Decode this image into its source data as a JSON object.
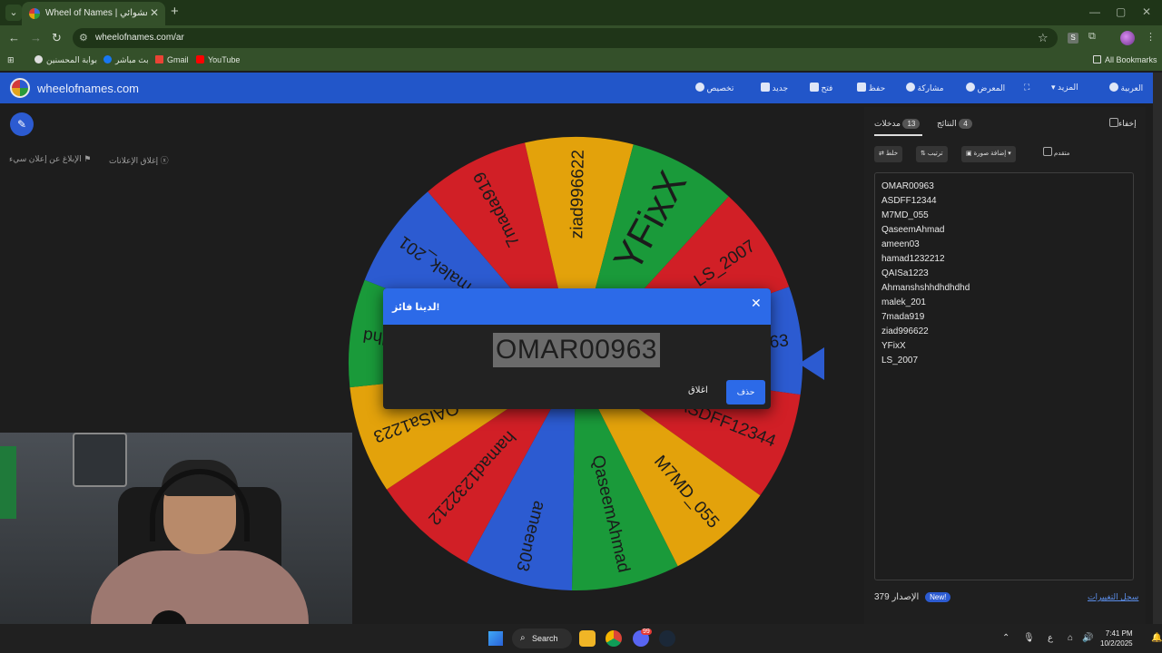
{
  "browser": {
    "tab_title": "Wheel of Names | اسم العشوائي",
    "url": "wheelofnames.com/ar",
    "bookmarks": [
      "بوابة المحسنين",
      "بث مباشر",
      "Gmail",
      "YouTube"
    ],
    "all_bookmarks": "All Bookmarks"
  },
  "site": {
    "brand": "wheelofnames.com",
    "menu": [
      "تخصيص",
      "جديد",
      "فتح",
      "حفظ",
      "مشاركة",
      "المعرض",
      "المزيد",
      "العربية"
    ],
    "close_ads": "إغلاق الإعلانات",
    "report_ad": "الإبلاغ عن إعلان سيء"
  },
  "wheel": {
    "slices": [
      "OMAR00963",
      "ASDFF12344",
      "M7MD_055",
      "QaseemAhmad",
      "ameen03",
      "hamad1232212",
      "QAISa1223",
      "Ahmanshshhdhdhdhd",
      "malek_201",
      "7mada919",
      "ziad996622",
      "YFixX",
      "LS_2007"
    ],
    "colors": [
      "#2c5bd1",
      "#d11f26",
      "#e3a20b",
      "#1a9a3a"
    ]
  },
  "modal": {
    "title": "لدينا فائز!",
    "winner": "OMAR00963",
    "close_label": "اغلاق",
    "delete_label": "حذف"
  },
  "panel": {
    "hide_label": "إخفاء",
    "tab_entries": "مدخلات",
    "entries_count": "13",
    "tab_results": "النتائج",
    "results_count": "4",
    "shuffle": "خلط",
    "sort": "ترتيب",
    "add_image": "إضافة صورة",
    "advanced": "متقدم",
    "entries": [
      "OMAR00963",
      "ASDFF12344",
      "M7MD_055",
      "QaseemAhmad",
      "ameen03",
      "hamad1232212",
      "QAISa1223",
      "Ahmanshshhdhdhdhd",
      "malek_201",
      "7mada919",
      "ziad996622",
      "YFixX",
      "LS_2007"
    ],
    "version_label": "الإصدار",
    "version": "379",
    "new_badge": "New!",
    "changelog": "سجل التغييرات"
  },
  "taskbar": {
    "search": "Search",
    "lang": "ع",
    "time": "7:41 PM",
    "date": "10/2/2025",
    "badge": "99"
  }
}
